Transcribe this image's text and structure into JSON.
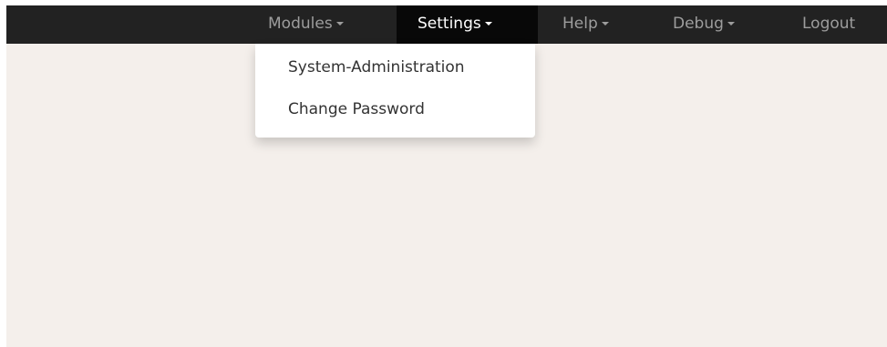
{
  "navbar": {
    "items": [
      {
        "label": "Modules",
        "has_caret": true,
        "active": false
      },
      {
        "label": "Settings",
        "has_caret": true,
        "active": true
      },
      {
        "label": "Help",
        "has_caret": true,
        "active": false
      },
      {
        "label": "Debug",
        "has_caret": true,
        "active": false
      },
      {
        "label": "Logout",
        "has_caret": false,
        "active": false
      }
    ]
  },
  "settings_menu": {
    "items": [
      {
        "label": "System-Administration"
      },
      {
        "label": "Change Password"
      }
    ]
  },
  "icons": {
    "caret": "caret-down-icon"
  },
  "colors": {
    "navbar_bg": "#222222",
    "navbar_active_bg": "#080808",
    "navbar_text": "#9d9d9d",
    "navbar_active_text": "#ffffff",
    "page_bg": "#f4efeb",
    "menu_bg": "#ffffff",
    "menu_text": "#333333"
  }
}
